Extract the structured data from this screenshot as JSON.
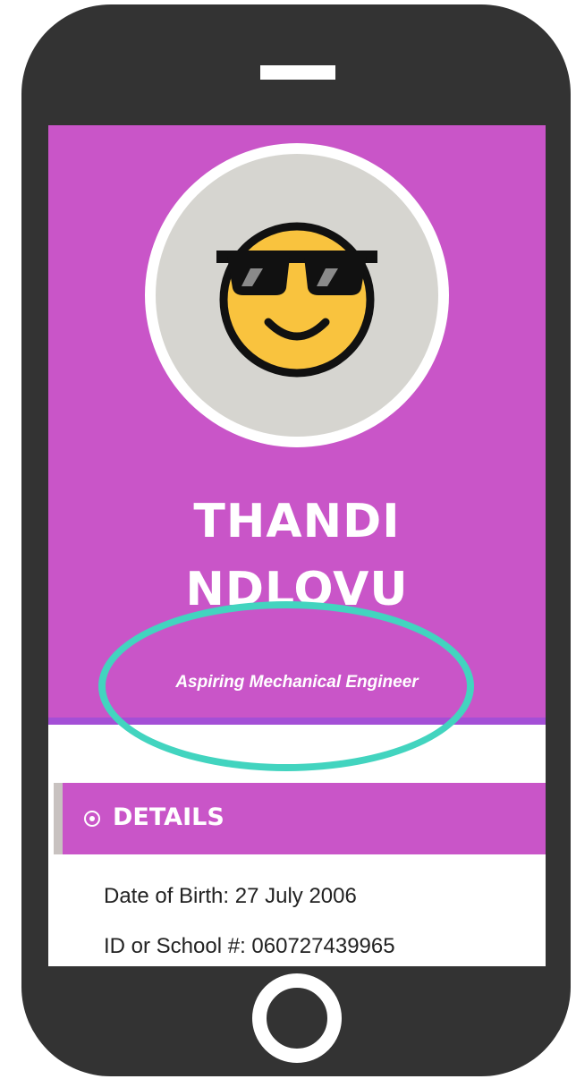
{
  "profile": {
    "name_line1": "THANDI",
    "name_line2": "NDLOVU",
    "title": "Aspiring Mechanical Engineer",
    "avatar_icon": "cool-sunglasses-emoji-icon"
  },
  "details": {
    "heading": "DETAILS",
    "icon": "circle-dot-icon",
    "rows": [
      {
        "text": "Date of Birth: 27 July 2006"
      },
      {
        "text": "ID or School #: 060727439965"
      }
    ]
  },
  "colors": {
    "frame": "#333333",
    "accent": "#c955c8",
    "accent_border": "#a44fd6",
    "highlight": "#42d4bf",
    "emoji_face": "#f9c33e",
    "avatar_bg": "#d6d5d0"
  }
}
